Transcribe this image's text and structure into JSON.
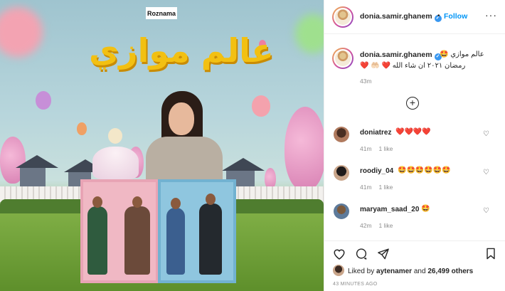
{
  "poster": {
    "logo": "Roznama",
    "title": "عالم موازي"
  },
  "post": {
    "username": "donia.samir.ghanem",
    "verified_mark": "✓",
    "dot": "•",
    "follow_label": "Follow",
    "more_label": "···",
    "caption_line1": "عالم موازي 🤩",
    "caption_line2": "رمضان ٢٠٢١ ان شاء الله ❤️ 🤲🏻 ❤️",
    "caption_time": "43m",
    "load_more": "+"
  },
  "comments": [
    {
      "user": "doniatrez",
      "text": "❤️❤️❤️❤️",
      "age": "41m",
      "likes": "1 like",
      "avatar_color": "#b07a5e"
    },
    {
      "user": "roodiy_04",
      "text": "🤩🤩🤩🤩🤩🤩",
      "age": "41m",
      "likes": "1 like",
      "avatar_color": "#3c3a3a"
    },
    {
      "user": "maryam_saad_20",
      "text": "🤩",
      "age": "42m",
      "likes": "1 like",
      "avatar_color": "#5d7a9a"
    }
  ],
  "actions": {
    "like_icon": "heart-outline-icon",
    "comment_icon": "comment-icon",
    "share_icon": "share-icon",
    "save_icon": "bookmark-icon"
  },
  "likes": {
    "prefix": "Liked by ",
    "user": "aytenamer",
    "middle": " and ",
    "count": "26,499 others"
  },
  "time_ago": "43 MINUTES AGO",
  "colors": {
    "link_blue": "#0095f6",
    "verified_blue": "#3897f0",
    "meta_gray": "#8e8e8e",
    "title_yellow": "#f2c012"
  }
}
